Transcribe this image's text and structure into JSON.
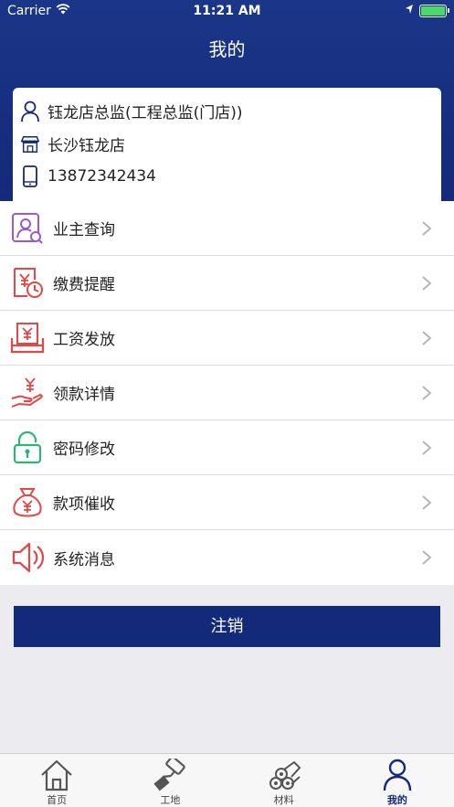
{
  "status_bar": {
    "carrier": "Carrier",
    "time": "11:21 AM"
  },
  "header": {
    "title": "我的"
  },
  "profile": {
    "role": "钰龙店总监(工程总监(门店))",
    "store": "长沙钰龙店",
    "phone": "13872342434"
  },
  "menu": [
    {
      "label": "业主查询",
      "icon": "owner-search-icon",
      "color": "#9b59d0"
    },
    {
      "label": "缴费提醒",
      "icon": "payment-reminder-icon",
      "color": "#e84545"
    },
    {
      "label": "工资发放",
      "icon": "salary-icon",
      "color": "#e84545"
    },
    {
      "label": "领款详情",
      "icon": "receive-money-icon",
      "color": "#e84545"
    },
    {
      "label": "密码修改",
      "icon": "lock-icon",
      "color": "#2bb673"
    },
    {
      "label": "款项催收",
      "icon": "money-bag-icon",
      "color": "#e84545"
    },
    {
      "label": "系统消息",
      "icon": "speaker-icon",
      "color": "#e84545"
    }
  ],
  "logout_label": "注销",
  "tabs": [
    {
      "label": "首页",
      "icon": "home-icon"
    },
    {
      "label": "工地",
      "icon": "roller-icon"
    },
    {
      "label": "材料",
      "icon": "materials-icon"
    },
    {
      "label": "我的",
      "icon": "person-icon",
      "active": true
    }
  ],
  "colors": {
    "brand": "#13297a",
    "background": "#ebebf0",
    "battery": "#4cd964"
  }
}
